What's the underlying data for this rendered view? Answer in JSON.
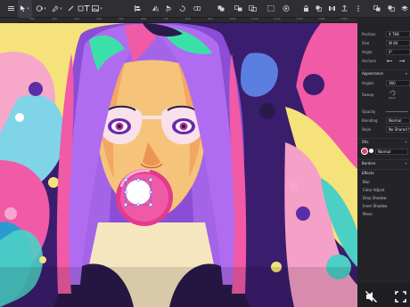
{
  "toolbar": {
    "tools": [
      "select-tool",
      "node-tool",
      "pen-tool",
      "brush-tool",
      "shape-tool",
      "text-tool",
      "image-tool"
    ],
    "title_indicator": "▾"
  },
  "ruler": {
    "labels": [
      "100",
      "200",
      "300",
      "400",
      "500",
      "600",
      "700",
      "800",
      "900",
      "1000",
      "1100",
      "1200",
      "1300",
      "1400",
      "1500"
    ]
  },
  "panel": {
    "position_label": "Position",
    "position_value": "X 768",
    "size_label": "Size",
    "size_value": "W 84",
    "angle_label": "Angle",
    "angle_value": "0°",
    "anchors_label": "Anchors",
    "appearance_label": "Appearance",
    "radius_angle_label": "Angles",
    "radius_angle_value": "360",
    "sweep_label": "Sweep",
    "sweep_value": "Open",
    "opacity_label": "Opacity",
    "blending_label": "Blending",
    "blending_value": "Normal",
    "style_label": "Style",
    "style_value": "No Shared Style",
    "fills_label": "Fills",
    "fill_mode": "Normal",
    "borders_label": "Borders",
    "effects_label": "Effects",
    "effects": [
      "Blur",
      "Color Adjust",
      "Drop Shadow",
      "Inner Shadow",
      "Move"
    ]
  },
  "colors": {
    "toolbar_bg": "#2e2e33",
    "panel_bg": "#242428",
    "accent": "#e33a6e",
    "selection": "#2d6cff"
  },
  "bottom": {
    "mute_icon": "speaker-muted-icon",
    "fullscreen_icon": "fullscreen-icon"
  }
}
